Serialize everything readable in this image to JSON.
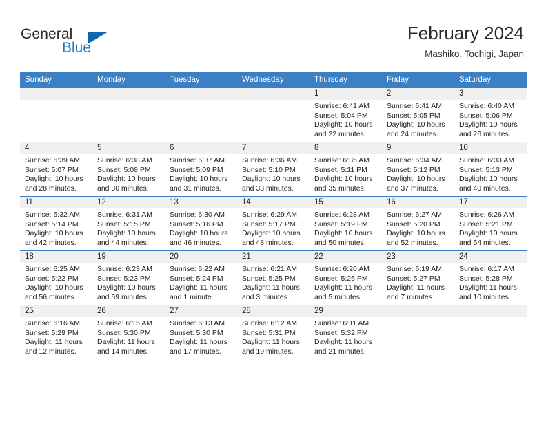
{
  "brand": {
    "name_part1": "General",
    "name_part2": "Blue",
    "logo_icon": "triangle-logo-icon"
  },
  "header": {
    "title": "February 2024",
    "subtitle": "Mashiko, Tochigi, Japan"
  },
  "calendar": {
    "weekday_headers": [
      "Sunday",
      "Monday",
      "Tuesday",
      "Wednesday",
      "Thursday",
      "Friday",
      "Saturday"
    ],
    "header_bg": "#3b7fc4",
    "daynum_band_bg": "#f0f0f0",
    "grid_line": "#3b7fc4",
    "weeks": [
      [
        {
          "day": "",
          "lines": []
        },
        {
          "day": "",
          "lines": []
        },
        {
          "day": "",
          "lines": []
        },
        {
          "day": "",
          "lines": []
        },
        {
          "day": "1",
          "lines": [
            "Sunrise: 6:41 AM",
            "Sunset: 5:04 PM",
            "Daylight: 10 hours",
            "and 22 minutes."
          ]
        },
        {
          "day": "2",
          "lines": [
            "Sunrise: 6:41 AM",
            "Sunset: 5:05 PM",
            "Daylight: 10 hours",
            "and 24 minutes."
          ]
        },
        {
          "day": "3",
          "lines": [
            "Sunrise: 6:40 AM",
            "Sunset: 5:06 PM",
            "Daylight: 10 hours",
            "and 26 minutes."
          ]
        }
      ],
      [
        {
          "day": "4",
          "lines": [
            "Sunrise: 6:39 AM",
            "Sunset: 5:07 PM",
            "Daylight: 10 hours",
            "and 28 minutes."
          ]
        },
        {
          "day": "5",
          "lines": [
            "Sunrise: 6:38 AM",
            "Sunset: 5:08 PM",
            "Daylight: 10 hours",
            "and 30 minutes."
          ]
        },
        {
          "day": "6",
          "lines": [
            "Sunrise: 6:37 AM",
            "Sunset: 5:09 PM",
            "Daylight: 10 hours",
            "and 31 minutes."
          ]
        },
        {
          "day": "7",
          "lines": [
            "Sunrise: 6:36 AM",
            "Sunset: 5:10 PM",
            "Daylight: 10 hours",
            "and 33 minutes."
          ]
        },
        {
          "day": "8",
          "lines": [
            "Sunrise: 6:35 AM",
            "Sunset: 5:11 PM",
            "Daylight: 10 hours",
            "and 35 minutes."
          ]
        },
        {
          "day": "9",
          "lines": [
            "Sunrise: 6:34 AM",
            "Sunset: 5:12 PM",
            "Daylight: 10 hours",
            "and 37 minutes."
          ]
        },
        {
          "day": "10",
          "lines": [
            "Sunrise: 6:33 AM",
            "Sunset: 5:13 PM",
            "Daylight: 10 hours",
            "and 40 minutes."
          ]
        }
      ],
      [
        {
          "day": "11",
          "lines": [
            "Sunrise: 6:32 AM",
            "Sunset: 5:14 PM",
            "Daylight: 10 hours",
            "and 42 minutes."
          ]
        },
        {
          "day": "12",
          "lines": [
            "Sunrise: 6:31 AM",
            "Sunset: 5:15 PM",
            "Daylight: 10 hours",
            "and 44 minutes."
          ]
        },
        {
          "day": "13",
          "lines": [
            "Sunrise: 6:30 AM",
            "Sunset: 5:16 PM",
            "Daylight: 10 hours",
            "and 46 minutes."
          ]
        },
        {
          "day": "14",
          "lines": [
            "Sunrise: 6:29 AM",
            "Sunset: 5:17 PM",
            "Daylight: 10 hours",
            "and 48 minutes."
          ]
        },
        {
          "day": "15",
          "lines": [
            "Sunrise: 6:28 AM",
            "Sunset: 5:19 PM",
            "Daylight: 10 hours",
            "and 50 minutes."
          ]
        },
        {
          "day": "16",
          "lines": [
            "Sunrise: 6:27 AM",
            "Sunset: 5:20 PM",
            "Daylight: 10 hours",
            "and 52 minutes."
          ]
        },
        {
          "day": "17",
          "lines": [
            "Sunrise: 6:26 AM",
            "Sunset: 5:21 PM",
            "Daylight: 10 hours",
            "and 54 minutes."
          ]
        }
      ],
      [
        {
          "day": "18",
          "lines": [
            "Sunrise: 6:25 AM",
            "Sunset: 5:22 PM",
            "Daylight: 10 hours",
            "and 56 minutes."
          ]
        },
        {
          "day": "19",
          "lines": [
            "Sunrise: 6:23 AM",
            "Sunset: 5:23 PM",
            "Daylight: 10 hours",
            "and 59 minutes."
          ]
        },
        {
          "day": "20",
          "lines": [
            "Sunrise: 6:22 AM",
            "Sunset: 5:24 PM",
            "Daylight: 11 hours",
            "and 1 minute."
          ]
        },
        {
          "day": "21",
          "lines": [
            "Sunrise: 6:21 AM",
            "Sunset: 5:25 PM",
            "Daylight: 11 hours",
            "and 3 minutes."
          ]
        },
        {
          "day": "22",
          "lines": [
            "Sunrise: 6:20 AM",
            "Sunset: 5:26 PM",
            "Daylight: 11 hours",
            "and 5 minutes."
          ]
        },
        {
          "day": "23",
          "lines": [
            "Sunrise: 6:19 AM",
            "Sunset: 5:27 PM",
            "Daylight: 11 hours",
            "and 7 minutes."
          ]
        },
        {
          "day": "24",
          "lines": [
            "Sunrise: 6:17 AM",
            "Sunset: 5:28 PM",
            "Daylight: 11 hours",
            "and 10 minutes."
          ]
        }
      ],
      [
        {
          "day": "25",
          "lines": [
            "Sunrise: 6:16 AM",
            "Sunset: 5:29 PM",
            "Daylight: 11 hours",
            "and 12 minutes."
          ]
        },
        {
          "day": "26",
          "lines": [
            "Sunrise: 6:15 AM",
            "Sunset: 5:30 PM",
            "Daylight: 11 hours",
            "and 14 minutes."
          ]
        },
        {
          "day": "27",
          "lines": [
            "Sunrise: 6:13 AM",
            "Sunset: 5:30 PM",
            "Daylight: 11 hours",
            "and 17 minutes."
          ]
        },
        {
          "day": "28",
          "lines": [
            "Sunrise: 6:12 AM",
            "Sunset: 5:31 PM",
            "Daylight: 11 hours",
            "and 19 minutes."
          ]
        },
        {
          "day": "29",
          "lines": [
            "Sunrise: 6:11 AM",
            "Sunset: 5:32 PM",
            "Daylight: 11 hours",
            "and 21 minutes."
          ]
        },
        {
          "day": "",
          "lines": []
        },
        {
          "day": "",
          "lines": []
        }
      ]
    ]
  }
}
